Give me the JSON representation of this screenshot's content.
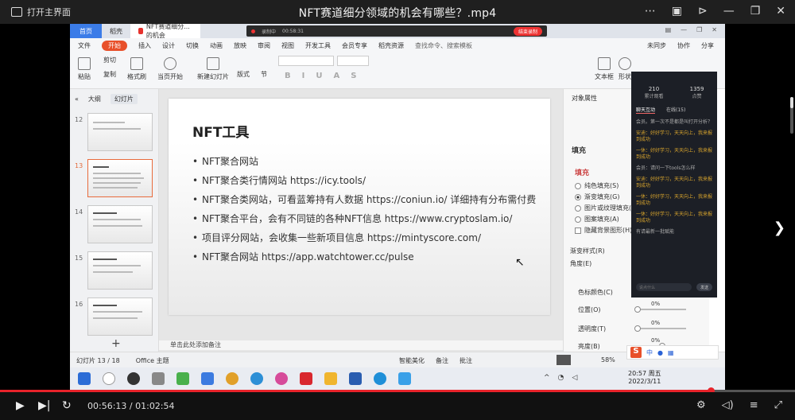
{
  "player": {
    "home_label": "打开主界面",
    "title": "NFT赛道细分领域的机会有哪些？.mp4",
    "time_current": "00:56:13",
    "time_separator": " / ",
    "time_total": "01:02:54",
    "progress_fraction": 0.894,
    "accent": "#e8232a"
  },
  "wps": {
    "tabs": [
      "首页",
      "稻壳",
      "NFT赛道细分...的机会"
    ],
    "recorder": {
      "time": "00:58:31",
      "label": "录制中",
      "end_label": "结束录制"
    },
    "menu": [
      "文件",
      "开始",
      "插入",
      "设计",
      "切换",
      "动画",
      "放映",
      "审阅",
      "视图",
      "开发工具",
      "会员专享",
      "稻壳资源"
    ],
    "search_placeholder": "查找命令、搜索模板",
    "menu_right": [
      "未同步",
      "协作",
      "分享"
    ],
    "ribbon": [
      "粘贴",
      "剪切",
      "复制",
      "格式刷",
      "当页开始",
      "新建幻灯片",
      "版式",
      "节",
      "文本框",
      "形状"
    ],
    "thumbnails": {
      "tab_outline": "大纲",
      "tab_slides": "幻灯片",
      "items": [
        {
          "num": "12",
          "selected": false
        },
        {
          "num": "13",
          "selected": true
        },
        {
          "num": "14",
          "selected": false
        },
        {
          "num": "15",
          "selected": false
        },
        {
          "num": "16",
          "selected": false
        }
      ]
    },
    "slide": {
      "title": "NFT工具",
      "bullets": [
        "NFT聚合网站",
        "NFT聚合类行情网站 https://icy.tools/",
        "NFT聚合类网站，可看蓝筹持有人数据 https://coniun.io/ 详细持有分布需付费",
        "NFT聚合平台，会有不同链的各种NFT信息 https://www.cryptoslam.io/",
        "项目评分网站，会收集一些新项目信息 https://mintyscore.com/",
        "NFT聚合网站 https://app.watchtower.cc/pulse"
      ]
    },
    "notes_placeholder": "单击此处添加备注",
    "props": {
      "header": "对象属性",
      "section_fill": "填充",
      "fill_heading": "填充",
      "options": [
        "纯色填充(S)",
        "渐变填充(G)",
        "图片或纹理填充(P)",
        "图案填充(A)",
        "隐藏背景图形(H)"
      ],
      "selected_option": 1,
      "gradient_style": "渐变样式(R)",
      "angle": "角度(E)",
      "color_stop": "色标颜色(C)",
      "rows": [
        {
          "label": "位置(O)",
          "value": "0%"
        },
        {
          "label": "透明度(T)",
          "value": "0%"
        },
        {
          "label": "亮度(B)",
          "value": "0%"
        }
      ],
      "apply_all": "全部应用",
      "reset_bg": "重置背景"
    },
    "chat": {
      "stats": [
        {
          "value": "210",
          "label": "累计观看"
        },
        {
          "value": "1359",
          "label": "点赞"
        }
      ],
      "tabs": [
        "聊天互动",
        "在线(15)"
      ],
      "messages": [
        "会员。第一次不是都是叫打开分析？",
        "安迪：好好学习，天天向上，我来报到成功",
        "一休：好好学习，天天向上，我来报到成功",
        "会员：请问一下tools怎么样",
        "安迪：好好学习，天天向上，我来报到成功",
        "一休：好好学习，天天向上，我来报到成功",
        "一休：好好学习，天天向上，我来报到成功",
        "有请最新一批赋能"
      ],
      "input_placeholder": "说点什么",
      "send_label": "发送"
    },
    "status": {
      "slide_counter": "幻灯片 13 / 18",
      "theme": "Office 主题",
      "smart": "智能美化",
      "notes": "备注",
      "comments": "批注",
      "zoom": "58%"
    },
    "ime": "中",
    "taskbar": {
      "time": "20:57 周五",
      "date": "2022/3/11"
    }
  }
}
